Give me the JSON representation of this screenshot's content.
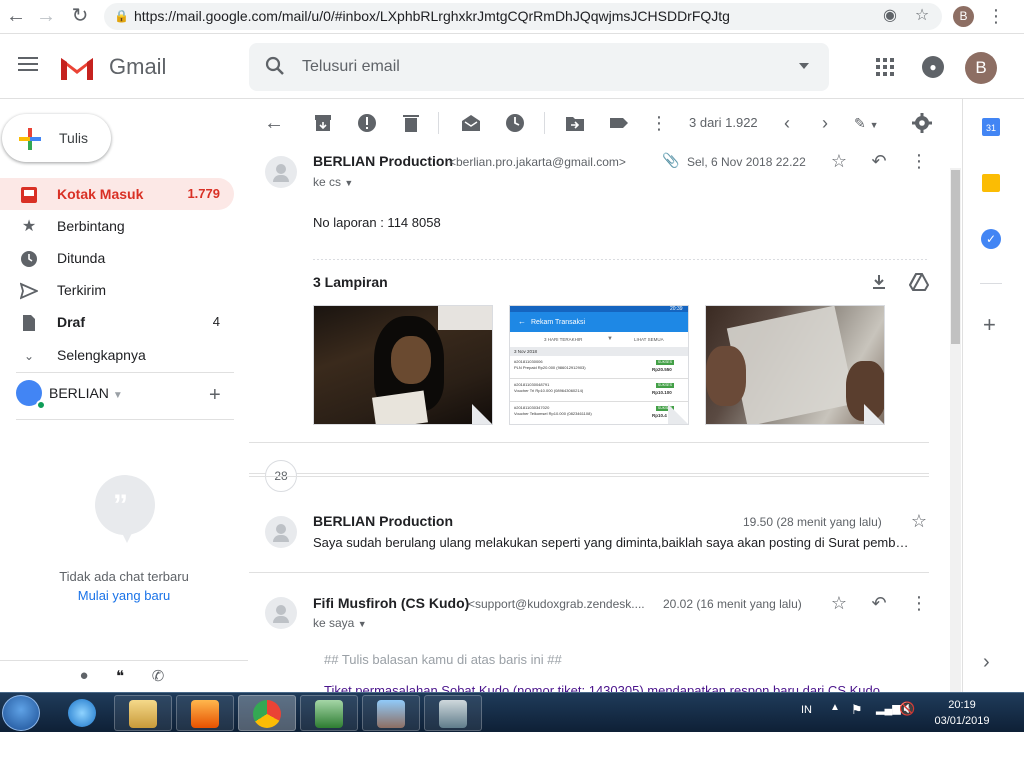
{
  "browser": {
    "url": "https://mail.google.com/mail/u/0/#inbox/LXphbRLrghxkrJmtgCQrRmDhJQqwjmsJCHSDDrFQJtg",
    "profile_initial": "B"
  },
  "header": {
    "app_name": "Gmail",
    "search_placeholder": "Telusuri email",
    "avatar_initial": "B"
  },
  "sidebar": {
    "compose_label": "Tulis",
    "items": [
      {
        "label": "Kotak Masuk",
        "count": "1.779",
        "icon": "inbox-icon"
      },
      {
        "label": "Berbintang",
        "count": "",
        "icon": "star-icon"
      },
      {
        "label": "Ditunda",
        "count": "",
        "icon": "clock-icon"
      },
      {
        "label": "Terkirim",
        "count": "",
        "icon": "send-icon"
      },
      {
        "label": "Draf",
        "count": "4",
        "icon": "draft-icon"
      },
      {
        "label": "Selengkapnya",
        "count": "",
        "icon": "chevron-down-icon"
      }
    ],
    "account_name": "BERLIAN",
    "no_chat_text": "Tidak ada chat terbaru",
    "start_new_link": "Mulai yang baru"
  },
  "toolbar": {
    "pagination": "3 dari 1.922"
  },
  "thread": {
    "msg1": {
      "sender": "BERLIAN Production",
      "email": "<berlian.pro.jakarta@gmail.com>",
      "date": "Sel, 6 Nov 2018 22.22",
      "to": "ke cs",
      "body": "No laporan : 114 8058"
    },
    "attachments": {
      "title": "3 Lampiran",
      "thumb2_header": "Rekam Transaksi",
      "thumb2_tabs": [
        "3 HARI TERAKHIR",
        "LIHAT SEMUA"
      ],
      "thumb2_date": "3 Nov 2018",
      "thumb2_rows": [
        {
          "id": "#201811030006",
          "desc": "PLN Prepaid Rp20.000 (986012912903)",
          "amount": "Rp20.550"
        },
        {
          "id": "#201811030048791",
          "desc": "Voucher Tri Rp10.000 (089643060214)",
          "amount": "Rp10.100"
        },
        {
          "id": "#201811030347020",
          "desc": "Voucher Telkomsel Rp10.000 (0823461108)",
          "amount": "Rp10.4"
        }
      ],
      "thumb2_badge": "SUKSES",
      "thumb2_time": "20:39"
    },
    "collapsed_count": "28",
    "msg2": {
      "sender": "BERLIAN Production",
      "date": "19.50 (28 menit yang lalu)",
      "snippet": "Saya sudah berulang ulang melakukan seperti yang diminta,baiklah saya akan posting di Surat pemb…"
    },
    "msg3": {
      "sender": "Fifi Musfiroh (CS Kudo)",
      "email": "<support@kudoxgrab.zendesk....",
      "date": "20.02 (16 menit yang lalu)",
      "to": "ke saya",
      "line1": "## Tulis balasan kamu di atas baris ini ##",
      "line2": "Tiket permasalahan Sobat Kudo (nomor tiket: 1430305) mendapatkan respon baru dari CS Kudo"
    }
  },
  "right_panel": {
    "calendar_day": "31"
  },
  "taskbar": {
    "language": "IN",
    "time": "20:19",
    "date": "03/01/2019"
  },
  "colors": {
    "active_nav_bg": "#fce8e6",
    "active_nav_text": "#d93025",
    "link": "#1a73e8",
    "taskbar": "#1f3b5a"
  }
}
